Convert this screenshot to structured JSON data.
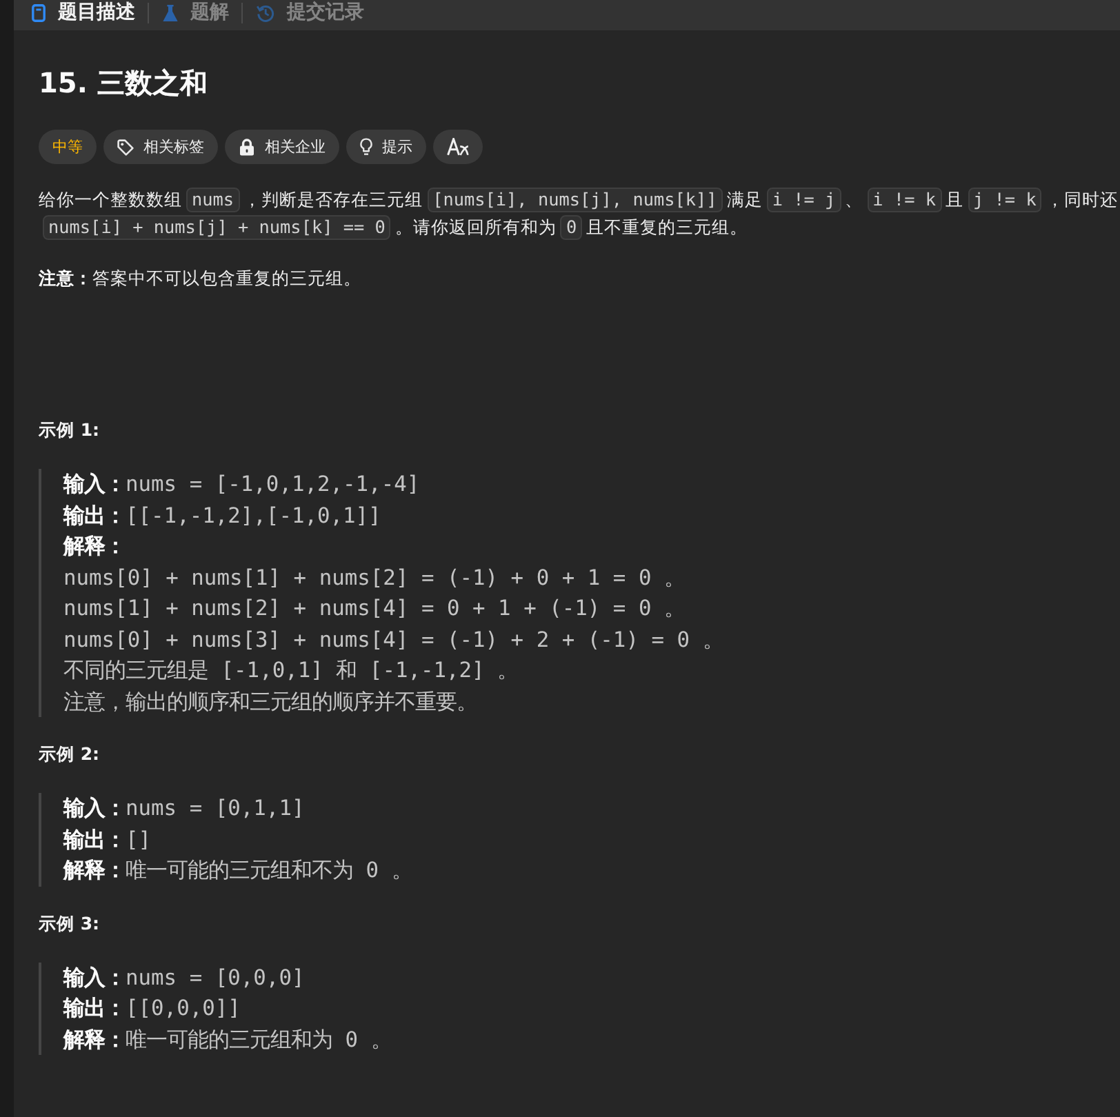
{
  "tabs": [
    {
      "kind": "description",
      "label": "题目描述",
      "selected": true
    },
    {
      "kind": "solutions",
      "label": "题解",
      "selected": false
    },
    {
      "kind": "submissions",
      "label": "提交记录",
      "selected": false
    }
  ],
  "title": "15. 三数之和",
  "tags": [
    {
      "kind": "difficulty",
      "label": "中等"
    },
    {
      "kind": "topics",
      "label": "相关标签"
    },
    {
      "kind": "companies",
      "label": "相关企业"
    },
    {
      "kind": "hint",
      "label": "提示"
    },
    {
      "kind": "translate"
    }
  ],
  "description": {
    "lines": [
      [
        {
          "kind": "text",
          "text": "给你一个整数数组"
        },
        {
          "kind": "code",
          "text": "nums"
        },
        {
          "kind": "text",
          "text": "，判断是否存在三元组"
        },
        {
          "kind": "code",
          "text": "[nums[i], nums[j], nums[k]]"
        },
        {
          "kind": "text",
          "text": "满足"
        },
        {
          "kind": "code",
          "text": "i != j"
        },
        {
          "kind": "text",
          "text": "、"
        },
        {
          "kind": "code",
          "text": "i != k"
        },
        {
          "kind": "text",
          "text": "且"
        },
        {
          "kind": "code",
          "text": "j != k"
        },
        {
          "kind": "text",
          "text": "，同时还"
        }
      ],
      [
        {
          "kind": "code",
          "text": "nums[i] + nums[j] + nums[k] == 0"
        },
        {
          "kind": "text",
          "text": "。请你返回所有和为"
        },
        {
          "kind": "code",
          "text": "0"
        },
        {
          "kind": "text",
          "text": "且不重复的三元组。"
        }
      ]
    ],
    "note": "**注意：**答案中不可以包含重复的三元组。"
  },
  "examples": [
    {
      "title": "示例 1:",
      "lines": [
        {
          "label": "输入：",
          "value": "nums = [-1,0,1,2,-1,-4]"
        },
        {
          "label": "输出：",
          "value": "[[-1,-1,2],[-1,0,1]]"
        },
        {
          "label": "解释："
        },
        {
          "value": "nums[0] + nums[1] + nums[2] = (-1) + 0 + 1 = 0 。"
        },
        {
          "value": "nums[1] + nums[2] + nums[4] = 0 + 1 + (-1) = 0 。"
        },
        {
          "value": "nums[0] + nums[3] + nums[4] = (-1) + 2 + (-1) = 0 。"
        },
        {
          "value": "不同的三元组是 [-1,0,1] 和 [-1,-1,2] 。"
        },
        {
          "value": "注意，输出的顺序和三元组的顺序并不重要。"
        }
      ]
    },
    {
      "title": "示例 2:",
      "lines": [
        {
          "label": "输入：",
          "value": "nums = [0,1,1]"
        },
        {
          "label": "输出：",
          "value": "[]"
        },
        {
          "label": "解释：",
          "value": "唯一可能的三元组和不为 0 。"
        }
      ]
    },
    {
      "title": "示例 3:",
      "lines": [
        {
          "label": "输入：",
          "value": "nums = [0,0,0]"
        },
        {
          "label": "输出：",
          "value": "[[0,0,0]]"
        },
        {
          "label": "解释：",
          "value": "唯一可能的三元组和为 0 。"
        }
      ]
    }
  ]
}
